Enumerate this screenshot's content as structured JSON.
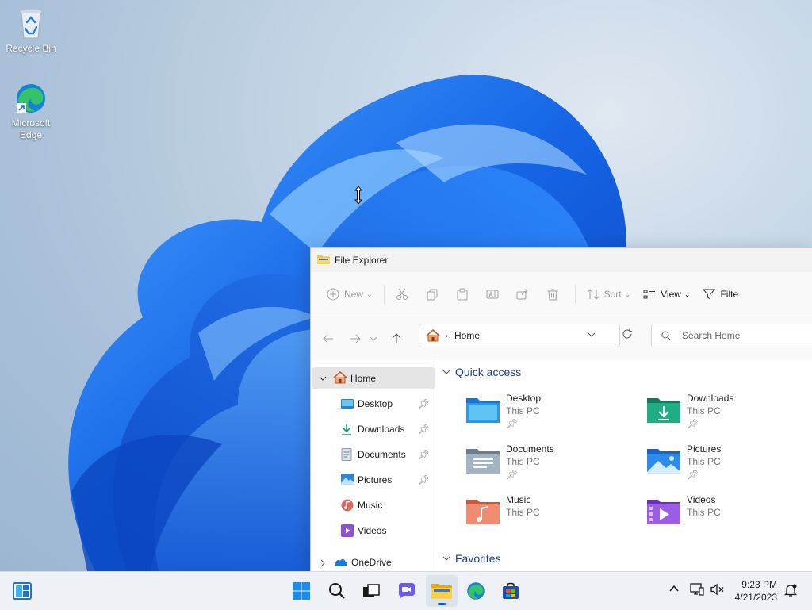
{
  "desktop": {
    "icons": [
      {
        "label": "Recycle Bin"
      },
      {
        "label": "Microsoft Edge"
      }
    ]
  },
  "explorer": {
    "title": "File Explorer",
    "commands": {
      "new": "New",
      "sort": "Sort",
      "view": "View",
      "filter": "Filte"
    },
    "address": {
      "location": "Home"
    },
    "search": {
      "placeholder": "Search Home"
    },
    "nav": [
      {
        "label": "Home",
        "selected": true
      },
      {
        "label": "Desktop",
        "pinned": true
      },
      {
        "label": "Downloads",
        "pinned": true
      },
      {
        "label": "Documents",
        "pinned": true
      },
      {
        "label": "Pictures",
        "pinned": true
      },
      {
        "label": "Music"
      },
      {
        "label": "Videos"
      },
      {
        "label": "OneDrive"
      }
    ],
    "sections": {
      "quick_access": "Quick access",
      "favorites": "Favorites"
    },
    "quick_access": [
      {
        "name": "Desktop",
        "location": "This PC",
        "pinned": true
      },
      {
        "name": "Downloads",
        "location": "This PC",
        "pinned": true
      },
      {
        "name": "Documents",
        "location": "This PC",
        "pinned": true
      },
      {
        "name": "Pictures",
        "location": "This PC",
        "pinned": true
      },
      {
        "name": "Music",
        "location": "This PC"
      },
      {
        "name": "Videos",
        "location": "This PC"
      }
    ]
  },
  "taskbar": {
    "time": "9:23 PM",
    "date": "4/21/2023"
  },
  "colors": {
    "accent": "#005fb8",
    "folder": "#f4c13a",
    "wallpaper_bloom": "#1e6fe8"
  }
}
